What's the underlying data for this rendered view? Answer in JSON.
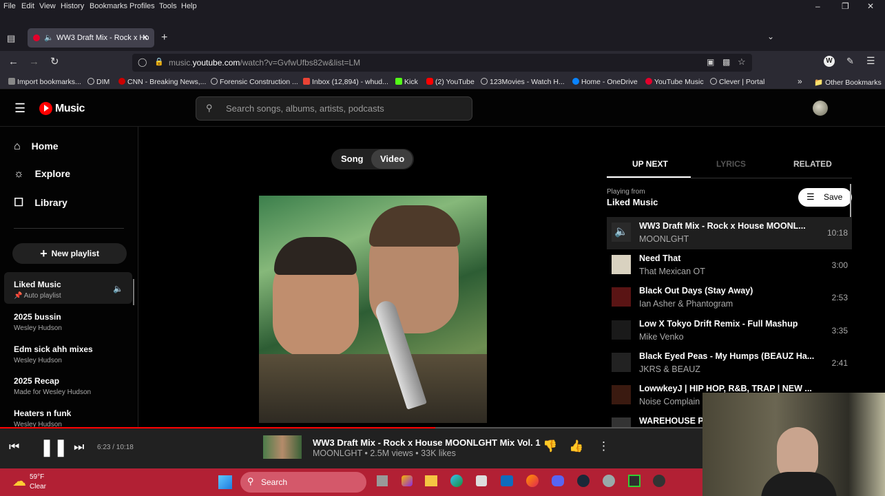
{
  "browser": {
    "menu": [
      "File",
      "Edit",
      "View",
      "History",
      "Bookmarks",
      "Profiles",
      "Tools",
      "Help"
    ],
    "tab_title": "WW3 Draft Mix - Rock x Ho",
    "url_prefix": "music.",
    "url_domain": "youtube.com",
    "url_path": "/watch?v=GvfwUfbs82w&list=LM",
    "bookmarks": [
      "Import bookmarks...",
      "DIM",
      "CNN - Breaking News,...",
      "Forensic Construction ...",
      "Inbox (12,894) - whud...",
      "Kick",
      "(2) YouTube",
      "123Movies - Watch H...",
      "Home - OneDrive",
      "YouTube Music",
      "Clever | Portal"
    ],
    "other_bookmarks": "Other Bookmarks"
  },
  "ytm": {
    "logo": "Music",
    "search_placeholder": "Search songs, albums, artists, podcasts",
    "nav": [
      "Home",
      "Explore",
      "Library"
    ],
    "new_playlist": "New playlist",
    "playlists": [
      {
        "title": "Liked Music",
        "subtitle": "Auto playlist"
      },
      {
        "title": "2025 bussin",
        "subtitle": "Wesley Hudson"
      },
      {
        "title": "Edm sick ahh mixes",
        "subtitle": "Wesley Hudson"
      },
      {
        "title": "2025 Recap",
        "subtitle": "Made for Wesley Hudson"
      },
      {
        "title": "Heaters n funk",
        "subtitle": "Wesley Hudson"
      }
    ],
    "toggle": {
      "song": "Song",
      "video": "Video"
    },
    "tabs": {
      "up_next": "UP NEXT",
      "lyrics": "LYRICS",
      "related": "RELATED"
    },
    "playing_from_label": "Playing from",
    "playing_from": "Liked Music",
    "save": "Save",
    "queue": [
      {
        "title": "WW3 Draft Mix - Rock x House MOONL...",
        "artist": "MOONLGHT",
        "duration": "10:18",
        "color": "#2a2a2a"
      },
      {
        "title": "Need That",
        "artist": "That Mexican OT",
        "duration": "3:00",
        "color": "#d9d2c0"
      },
      {
        "title": "Black Out Days (Stay Away)",
        "artist": "Ian Asher & Phantogram",
        "duration": "2:53",
        "color": "#5a1414"
      },
      {
        "title": "Low X Tokyo Drift Remix - Full Mashup",
        "artist": "Mike Venko",
        "duration": "3:35",
        "color": "#1a1a1a"
      },
      {
        "title": "Black Eyed Peas - My Humps (BEAUZ Ha...",
        "artist": "JKRS & BEAUZ",
        "duration": "2:41",
        "color": "#222"
      },
      {
        "title": "LowwkeyJ | HIP HOP, R&B, TRAP | NEW ...",
        "artist": "Noise Complain",
        "duration": "",
        "color": "#3a1a10"
      },
      {
        "title": "WAREHOUSE P",
        "artist": "",
        "duration": "",
        "color": "#333"
      }
    ],
    "player": {
      "time": "6:23 / 10:18",
      "progress": 0.62,
      "title": "WW3 Draft Mix - Rock x House MOONLGHT Mix Vol. 1",
      "meta": "MOONLGHT • 2.5M views • 33K likes"
    }
  },
  "taskbar": {
    "temp": "59°F",
    "weather": "Clear",
    "search": "Search"
  }
}
